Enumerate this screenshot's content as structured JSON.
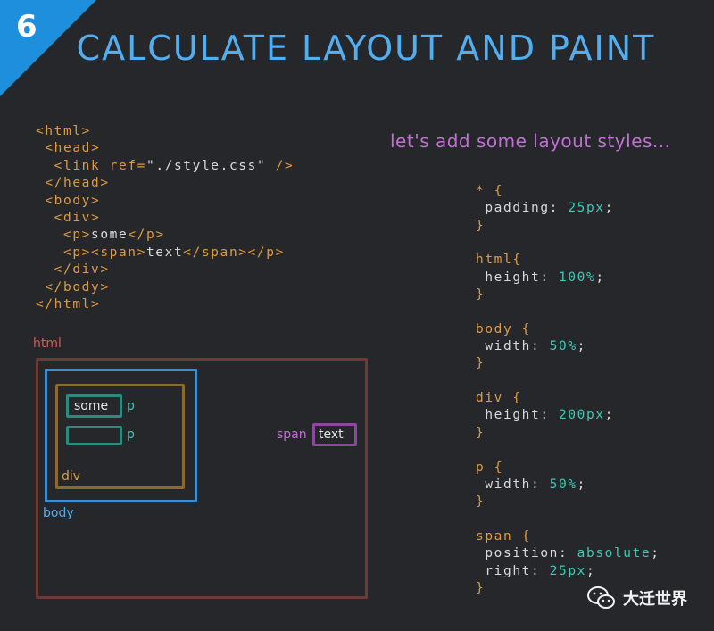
{
  "badge": {
    "number": "6"
  },
  "title": "CALCULATE LAYOUT AND PAINT",
  "note": "let's add some layout styles...",
  "html_code": [
    [
      [
        "t",
        "<html>"
      ]
    ],
    [
      [
        "p",
        " "
      ],
      [
        "t",
        "<head>"
      ]
    ],
    [
      [
        "p",
        "  "
      ],
      [
        "t",
        "<link ref="
      ],
      [
        "s",
        "\"./style.css\""
      ],
      [
        "t",
        " />"
      ]
    ],
    [
      [
        "p",
        " "
      ],
      [
        "t",
        "</head>"
      ]
    ],
    [
      [
        "p",
        " "
      ],
      [
        "t",
        "<body>"
      ]
    ],
    [
      [
        "p",
        "  "
      ],
      [
        "t",
        "<div>"
      ]
    ],
    [
      [
        "p",
        "   "
      ],
      [
        "t",
        "<p>"
      ],
      [
        "s",
        "some"
      ],
      [
        "t",
        "</p>"
      ]
    ],
    [
      [
        "p",
        "   "
      ],
      [
        "t",
        "<p><span>"
      ],
      [
        "s",
        "text"
      ],
      [
        "t",
        "</span></p>"
      ]
    ],
    [
      [
        "p",
        "  "
      ],
      [
        "t",
        "</div>"
      ]
    ],
    [
      [
        "p",
        " "
      ],
      [
        "t",
        "</body>"
      ]
    ],
    [
      [
        "t",
        "</html>"
      ]
    ]
  ],
  "css_code": [
    [
      [
        "sel",
        "* {"
      ]
    ],
    [
      [
        "p",
        " "
      ],
      [
        "prop",
        "padding: "
      ],
      [
        "val",
        "25px"
      ],
      [
        "p",
        ";"
      ]
    ],
    [
      [
        "sel",
        "}"
      ]
    ],
    [
      [
        "p",
        ""
      ]
    ],
    [
      [
        "sel",
        "html{"
      ]
    ],
    [
      [
        "p",
        " "
      ],
      [
        "prop",
        "height: "
      ],
      [
        "val",
        "100%"
      ],
      [
        "p",
        ";"
      ]
    ],
    [
      [
        "sel",
        "}"
      ]
    ],
    [
      [
        "p",
        ""
      ]
    ],
    [
      [
        "sel",
        "body {"
      ]
    ],
    [
      [
        "p",
        " "
      ],
      [
        "prop",
        "width: "
      ],
      [
        "val",
        "50%"
      ],
      [
        "p",
        ";"
      ]
    ],
    [
      [
        "sel",
        "}"
      ]
    ],
    [
      [
        "p",
        ""
      ]
    ],
    [
      [
        "sel",
        "div {"
      ]
    ],
    [
      [
        "p",
        " "
      ],
      [
        "prop",
        "height: "
      ],
      [
        "val",
        "200px"
      ],
      [
        "p",
        ";"
      ]
    ],
    [
      [
        "sel",
        "}"
      ]
    ],
    [
      [
        "p",
        ""
      ]
    ],
    [
      [
        "sel",
        "p {"
      ]
    ],
    [
      [
        "p",
        " "
      ],
      [
        "prop",
        "width: "
      ],
      [
        "val",
        "50%"
      ],
      [
        "p",
        ";"
      ]
    ],
    [
      [
        "sel",
        "}"
      ]
    ],
    [
      [
        "p",
        ""
      ]
    ],
    [
      [
        "sel",
        "span {"
      ]
    ],
    [
      [
        "p",
        " "
      ],
      [
        "prop",
        "position: "
      ],
      [
        "val",
        "absolute"
      ],
      [
        "p",
        ";"
      ]
    ],
    [
      [
        "p",
        " "
      ],
      [
        "prop",
        "right: "
      ],
      [
        "val",
        "25px"
      ],
      [
        "p",
        ";"
      ]
    ],
    [
      [
        "sel",
        "}"
      ]
    ]
  ],
  "diagram": {
    "html_label": "html",
    "body_label": "body",
    "div_label": "div",
    "p1_text": "some",
    "p1_label": "p",
    "p2_label": "p",
    "span_label": "span",
    "span_text": "text"
  },
  "watermark": "大迁世界",
  "colors": {
    "background": "#25272b",
    "title": "#53aef0",
    "tag": "#e09a3e",
    "value": "#3ec9b4",
    "note": "#c46fd6",
    "html_box": "#6e3a36",
    "body_box": "#3f8fcf",
    "div_box": "#8a6a2f",
    "p_box": "#2c8b7d",
    "span_box": "#8b4a9a"
  }
}
